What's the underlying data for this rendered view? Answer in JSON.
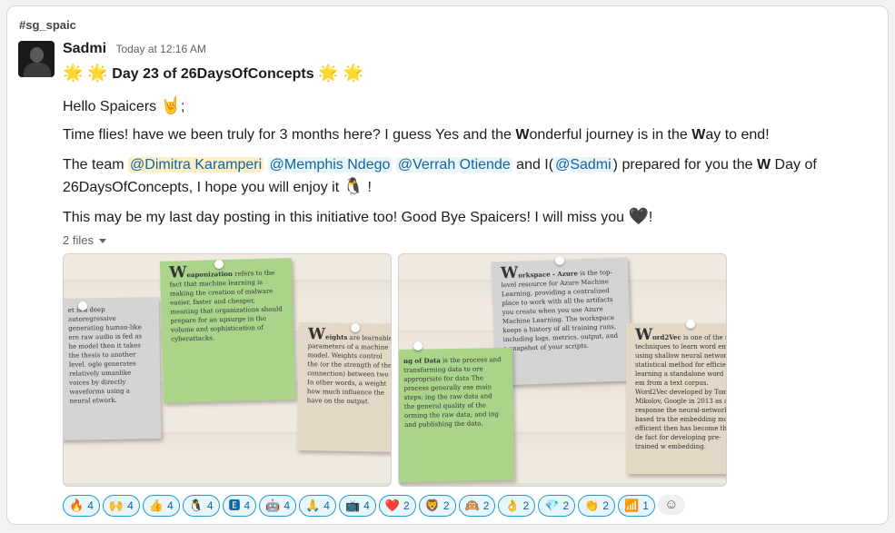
{
  "channel": "#sg_spaic",
  "author": "Sadmi",
  "timestamp": "Today at 12:16 AM",
  "title": {
    "stars_left": "🌟 🌟",
    "text": "Day 23 of 26DaysOfConcepts",
    "stars_right": "🌟 🌟"
  },
  "greeting": {
    "text": "Hello Spaicers",
    "emoji": "🤘",
    "after": ";"
  },
  "p1": {
    "a": "Time flies! have we been truly for 3 months here? I guess Yes and the ",
    "w1": "W",
    "b": "onderful journey is in the ",
    "w2": "W",
    "c": "ay to end!"
  },
  "p2": {
    "a": "The team ",
    "m1": "@Dimitra Karamperi",
    "m2": "@Memphis Ndego",
    "m3": "@Verrah Otiende",
    "b": " and I(",
    "m4": "@Sadmi",
    "c": ") prepared for you the ",
    "w": "W",
    "d": " Day of",
    "line2": "26DaysOfConcepts, I hope you will enjoy it",
    "emoji": "🐧",
    "end": "!"
  },
  "p3": {
    "text": "This may be my last day posting in this initiative too! Good Bye Spaicers! I will miss you",
    "emoji": "🖤",
    "end": "!"
  },
  "files_label": "2 files",
  "image1": {
    "note1": {
      "big": "W",
      "title": "eaponization",
      "body": "refers to the fact that machine learning is making the creation of malware easier, faster and cheaper, meaning that organizations should prepare for an upsurge in the volume and sophistication of cyberattacks."
    },
    "note2": {
      "body": "et is a deep autoregressive generating human-like ere raw audio is fed as he model then it takes the thesis to another level. ogle generates relatively umanlike voices by directly waveforms using a neural etwork."
    },
    "note3": {
      "big": "W",
      "title": "eights",
      "body": "are learnable parameters of a machine model. Weights control the (or the strength of the connection) between two In other words, a weight how much influence the have on the output."
    }
  },
  "image2": {
    "note1": {
      "big": "W",
      "title": "orkspace - Azure",
      "body": "is the top-level resource for Azure Machine Learning, providing a centralized place to work with all the artifacts you create when you use Azure Machine Learning. The workspace keeps a history of all training runs, including logs, metrics, output, and a snapshot of your scripts."
    },
    "note2": {
      "title": "ng of Data",
      "body": "is the process and transforming data to ore appropriate for data The process generally ese main steps: ing the raw data and the general quality of the orming the raw data; and ing and publishing the data."
    },
    "note3": {
      "big": "W",
      "title": "ord2Vec",
      "body": "is one of the m techniques to learn word emb using shallow neural network statistical method for efficie learning a standalone word em from a text corpus. Word2Vec developed by Tomas Mikolov, Google in 2013 as a response the neural-network-based tra the embedding more efficient then has become the de fact for developing pre-trained w embedding."
    }
  },
  "reactions": [
    {
      "emoji": "🔥",
      "count": "4"
    },
    {
      "emoji": "🙌",
      "count": "4"
    },
    {
      "emoji": "👍",
      "count": "4"
    },
    {
      "emoji": "🐧",
      "count": "4"
    },
    {
      "emoji": "🅴",
      "count": "4"
    },
    {
      "emoji": "🤖",
      "count": "4"
    },
    {
      "emoji": "🙏",
      "count": "4"
    },
    {
      "emoji": "📺",
      "count": "4"
    },
    {
      "emoji": "❤️",
      "count": "2"
    },
    {
      "emoji": "🦁",
      "count": "2"
    },
    {
      "emoji": "🙉",
      "count": "2"
    },
    {
      "emoji": "👌",
      "count": "2"
    },
    {
      "emoji": "💎",
      "count": "2"
    },
    {
      "emoji": "👏",
      "count": "2"
    },
    {
      "emoji": "📶",
      "count": "1"
    }
  ],
  "add_reaction_icon": "add-reaction-icon",
  "colors": {
    "mention_bg": "#e8f5fa",
    "mention_text": "#1264a3",
    "self_mention_bg": "#fcefc6",
    "note_green": "#a9d48a",
    "note_gray": "#d4d4d4",
    "note_beige": "#e3d7c5"
  }
}
